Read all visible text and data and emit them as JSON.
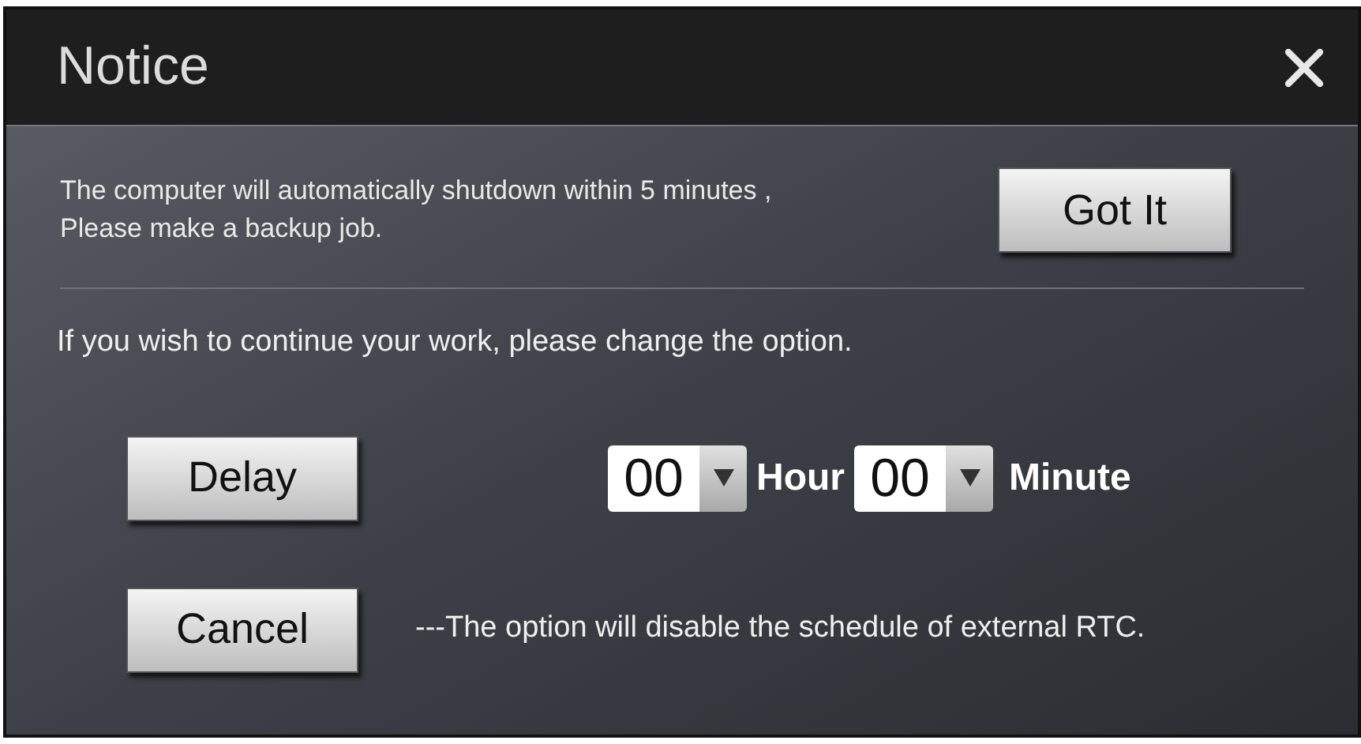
{
  "window": {
    "title": "Notice"
  },
  "message": {
    "lines": [
      "The computer will automatically shutdown within 5 minutes ,",
      "Please make a backup job."
    ],
    "button": "Got It"
  },
  "instruction": "If you wish to continue your work, please change the option.",
  "delay": {
    "button": "Delay",
    "hour": {
      "value": "00",
      "unit": "Hour"
    },
    "minute": {
      "value": "00",
      "unit": "Minute"
    }
  },
  "cancel": {
    "button": "Cancel",
    "note": "---The option will disable the schedule of external RTC."
  }
}
